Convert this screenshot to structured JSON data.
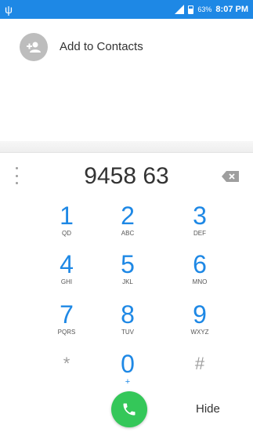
{
  "status_bar": {
    "usb_icon": "usb-icon",
    "battery_percent": "63%",
    "time": "8:07 PM",
    "color": "#1e88e5"
  },
  "contact": {
    "label": "Add to Contacts",
    "icon": "add-person-icon"
  },
  "dial": {
    "number": "9458 63",
    "backspace_icon": "backspace-icon",
    "menu_icon": "overflow-menu-icon"
  },
  "keypad": [
    {
      "num": "1",
      "sub": "QD"
    },
    {
      "num": "2",
      "sub": "ABC"
    },
    {
      "num": "3",
      "sub": "DEF"
    },
    {
      "num": "4",
      "sub": "GHI"
    },
    {
      "num": "5",
      "sub": "JKL"
    },
    {
      "num": "6",
      "sub": "MNO"
    },
    {
      "num": "7",
      "sub": "PQRS"
    },
    {
      "num": "8",
      "sub": "TUV"
    },
    {
      "num": "9",
      "sub": "WXYZ"
    },
    {
      "num": "*",
      "sub": ""
    },
    {
      "num": "0",
      "sub": "+"
    },
    {
      "num": "#",
      "sub": ""
    }
  ],
  "actions": {
    "call_icon": "phone-icon",
    "call_color": "#34c759",
    "hide_label": "Hide"
  }
}
